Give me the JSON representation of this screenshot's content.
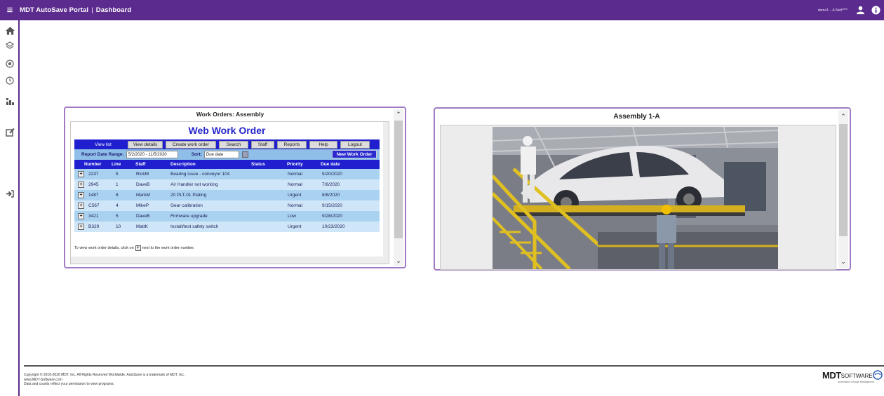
{
  "header": {
    "app_name": "MDT AutoSave Portal",
    "page": "Dashboard",
    "user": "demo1 – A.Nett****"
  },
  "colors": {
    "brand_purple": "#5b2b8e",
    "table_blue": "#1f1fd0",
    "row_light": "#a9d2f0"
  },
  "sidebar": {
    "items": [
      {
        "icon": "home-icon"
      },
      {
        "icon": "layers-icon"
      },
      {
        "icon": "globe-icon"
      },
      {
        "icon": "history-icon"
      },
      {
        "icon": "sitemap-icon"
      },
      {
        "icon": "edit-icon"
      },
      {
        "icon": "logout-icon"
      }
    ]
  },
  "work_orders_panel": {
    "title": "Work Orders: Assembly",
    "heading": "Web Work Order",
    "nav": [
      "View list",
      "View details",
      "Create work order",
      "Search",
      "Staff",
      "Reports",
      "Help",
      "Logout"
    ],
    "filter": {
      "range_label": "Report Date Range:",
      "range_value": "5/2/2020 - 11/5/2020",
      "sort_label": "Sort:",
      "sort_value": "Due date",
      "new_button": "New Work Order"
    },
    "columns": [
      "Number",
      "Line",
      "Staff",
      "Description",
      "Status",
      "Priority",
      "Due date"
    ],
    "rows": [
      {
        "number": "2237",
        "line": "5",
        "staff": "RickM",
        "description": "Bearing issue - conveyor 104",
        "status": "",
        "priority": "Normal",
        "due": "5/20/2020"
      },
      {
        "number": "2945",
        "line": "1",
        "staff": "DaveB",
        "description": "Air Handler not working",
        "status": "",
        "priority": "Normal",
        "due": "7/6/2020"
      },
      {
        "number": "1487",
        "line": "8",
        "staff": "MarkM",
        "description": "20 PLT-01 Plating",
        "status": "",
        "priority": "Urgent",
        "due": "8/6/2020"
      },
      {
        "number": "C567",
        "line": "4",
        "staff": "MikeP",
        "description": "Gear calibration",
        "status": "",
        "priority": "Normal",
        "due": "9/15/2020"
      },
      {
        "number": "3421",
        "line": "5",
        "staff": "DaveB",
        "description": "Firmware upgrade",
        "status": "",
        "priority": "Low",
        "due": "9/28/2020"
      },
      {
        "number": "B329",
        "line": "10",
        "staff": "MattK",
        "description": "Install/test safety switch",
        "status": "",
        "priority": "Urgent",
        "due": "10/23/2020"
      }
    ],
    "footnote_before": "To view work order details, click on",
    "footnote_after": "next to the work order number."
  },
  "image_panel": {
    "title": "Assembly 1-A"
  },
  "footer": {
    "copyright": "Copyright © 2016-2020 MDT, Inc. All Rights Reserved Worldwide. AutoSave is a trademark of MDT, Inc.",
    "website": "www.MDT-Software.com",
    "note": "Data and counts reflect your permission to view programs.",
    "logo_main": "MDT",
    "logo_sub": "SOFTWARE",
    "logo_tagline": "Automation Change Management"
  }
}
